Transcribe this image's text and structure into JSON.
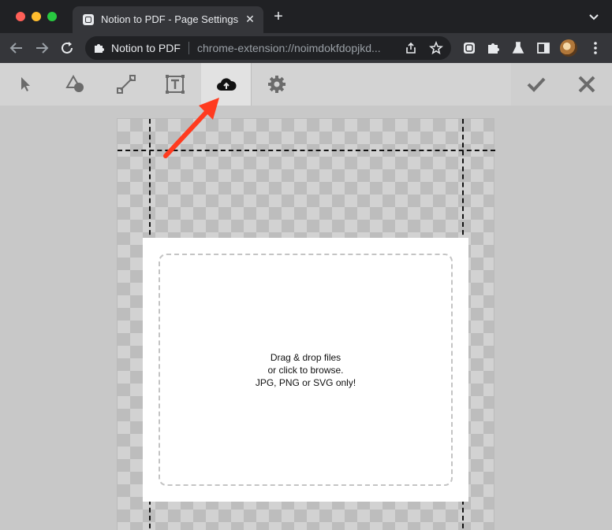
{
  "browser": {
    "tab_title": "Notion to PDF - Page Settings",
    "tab_close": "✕",
    "new_tab": "+",
    "omnibox": {
      "ext_name": "Notion to PDF",
      "url": "chrome-extension://noimdokfdopjkd..."
    }
  },
  "toolbar": {
    "tools": [
      {
        "id": "select",
        "icon": "cursor-icon"
      },
      {
        "id": "shapes",
        "icon": "shapes-icon"
      },
      {
        "id": "line",
        "icon": "line-icon"
      },
      {
        "id": "text",
        "icon": "text-icon"
      },
      {
        "id": "upload",
        "icon": "cloud-upload-icon",
        "active": true
      },
      {
        "id": "settings",
        "icon": "gear-icon"
      }
    ],
    "confirm_icon": "checkmark-icon",
    "cancel_icon": "close-icon"
  },
  "dropzone": {
    "line1": "Drag & drop files",
    "line2": "or click to browse.",
    "line3": "JPG, PNG or SVG only!"
  },
  "colors": {
    "annotation_arrow": "#ff3b1f",
    "tab_bar": "#202124",
    "app_toolbar": "#d3d3d3"
  }
}
